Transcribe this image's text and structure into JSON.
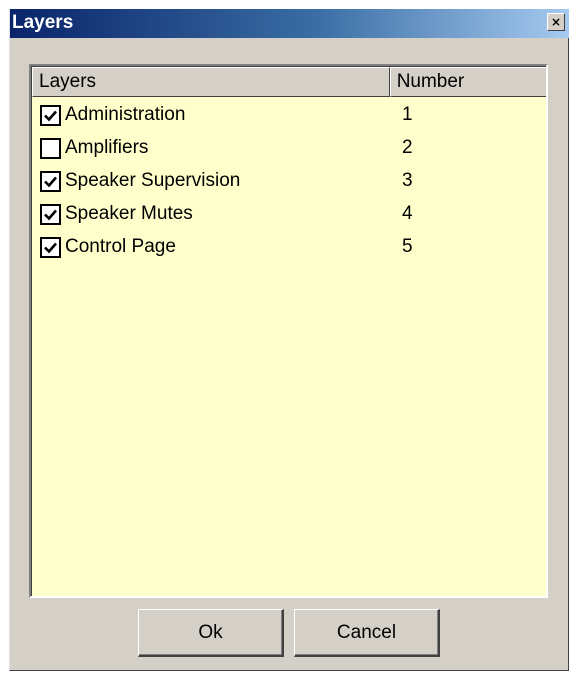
{
  "window": {
    "title": "Layers",
    "close_glyph": "×"
  },
  "list": {
    "columns": [
      "Layers",
      "Number"
    ],
    "rows": [
      {
        "label": "Administration",
        "number": "1",
        "checked": true
      },
      {
        "label": "Amplifiers",
        "number": "2",
        "checked": false
      },
      {
        "label": "Speaker Supervision",
        "number": "3",
        "checked": true
      },
      {
        "label": "Speaker Mutes",
        "number": "4",
        "checked": true
      },
      {
        "label": "Control Page",
        "number": "5",
        "checked": true
      }
    ],
    "background_color": "#ffffcc"
  },
  "buttons": {
    "ok_label": "Ok",
    "cancel_label": "Cancel"
  },
  "colors": {
    "titlebar_start": "#0a246a",
    "titlebar_end": "#a6caf0",
    "dialog_face": "#d4d0c8"
  },
  "icons": {
    "close": "close-icon",
    "check": "checkmark-icon"
  }
}
